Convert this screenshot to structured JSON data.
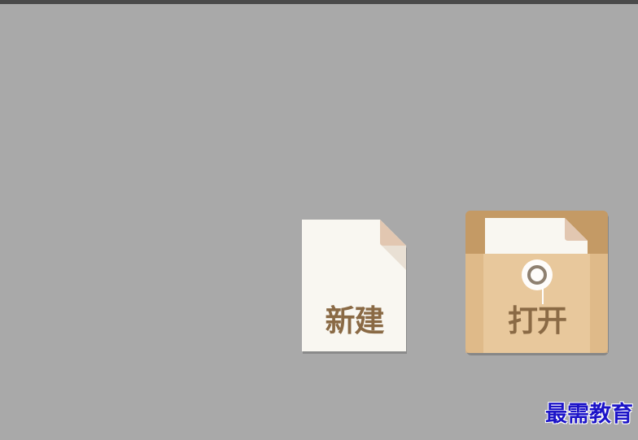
{
  "actions": {
    "new_label": "新建",
    "open_label": "打开"
  },
  "watermark": "最需教育",
  "colors": {
    "background": "#a9a9a9",
    "top_bar": "#4a4a4a",
    "paper": "#f9f7f1",
    "folder_back": "#c49a65",
    "folder_front": "#e8c89c",
    "label_text": "#8a6a45",
    "watermark": "#1c14c8"
  },
  "icons": {
    "new": "document-icon",
    "open": "folder-icon"
  }
}
